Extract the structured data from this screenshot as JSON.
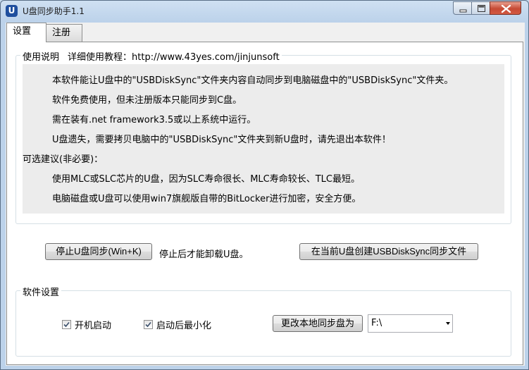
{
  "window": {
    "title": "U盘同步助手1.1",
    "icon_letter": "U"
  },
  "tabs": [
    {
      "label": "设置",
      "selected": true
    },
    {
      "label": "注册",
      "selected": false
    }
  ],
  "usage": {
    "legend_label": "使用说明",
    "tutorial_label": "详细使用教程：http://www.43yes.com/jinjunsoft",
    "lines": [
      "本软件能让U盘中的\"USBDiskSync\"文件夹内容自动同步到电脑磁盘中的\"USBDiskSync\"文件夹。",
      "软件免费使用，但未注册版本只能同步到C盘。",
      "需在装有.net framework3.5或以上系统中运行。",
      "U盘遗失，需要拷贝电脑中的\"USBDiskSync\"文件夹到新U盘时，请先退出本软件！",
      "可选建议(非必要)：",
      "使用MLC或SLC芯片的U盘，因为SLC寿命很长、MLC寿命较长、TLC最短。",
      "电脑磁盘或U盘可以使用win7旗舰版自带的BitLocker进行加密，安全方便。"
    ]
  },
  "actions": {
    "stop_sync_button": "停止U盘同步(Win+K)",
    "stop_hint": "停止后才能卸载U盘。",
    "create_file_button": "在当前U盘创建USBDiskSync同步文件"
  },
  "settings": {
    "legend_label": "软件设置",
    "autostart_label": "开机启动",
    "autostart_checked": true,
    "minimize_label": "启动后最小化",
    "minimize_checked": true,
    "change_drive_button": "更改本地同步盘为",
    "drive_value": "F:\\"
  },
  "colors": {
    "accent": "#1f4f9e",
    "close_button": "#c64a34"
  }
}
